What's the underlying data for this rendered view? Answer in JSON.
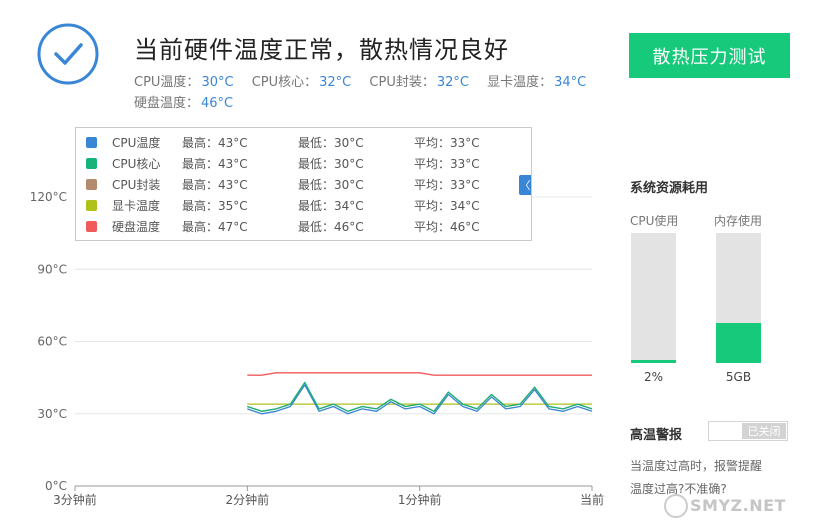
{
  "header": {
    "status_icon": "checkmark-circle-icon",
    "headline": "当前硬件温度正常，散热情况良好",
    "readings": [
      {
        "label": "CPU温度：",
        "value": "30°C"
      },
      {
        "label": "CPU核心：",
        "value": "32°C"
      },
      {
        "label": "CPU封装：",
        "value": "32°C"
      },
      {
        "label": "显卡温度：",
        "value": "34°C"
      },
      {
        "label": "硬盘温度：",
        "value": "46°C"
      }
    ],
    "stress_test_button": "散热压力测试"
  },
  "legend": {
    "rows": [
      {
        "name": "CPU温度",
        "max": "最高：43°C",
        "min": "最低：30°C",
        "avg": "平均：33°C",
        "color": "#3a86d6"
      },
      {
        "name": "CPU核心",
        "max": "最高：43°C",
        "min": "最低：30°C",
        "avg": "平均：33°C",
        "color": "#17b37a"
      },
      {
        "name": "CPU封装",
        "max": "最高：43°C",
        "min": "最低：30°C",
        "avg": "平均：33°C",
        "color": "#b38a6b"
      },
      {
        "name": "显卡温度",
        "max": "最高：35°C",
        "min": "最低：34°C",
        "avg": "平均：34°C",
        "color": "#aec21a"
      },
      {
        "name": "硬盘温度",
        "max": "最高：47°C",
        "min": "最低：46°C",
        "avg": "平均：46°C",
        "color": "#f05a5a"
      }
    ],
    "collapse_glyph": "〈"
  },
  "chart_data": {
    "type": "line",
    "ylabel": "",
    "xlabel": "",
    "y_ticks": [
      "120°C",
      "90°C",
      "60°C",
      "30°C",
      "0°C"
    ],
    "ylim": [
      0,
      120
    ],
    "x_ticks": [
      "3分钟前",
      "2分钟前",
      "1分钟前",
      "当前"
    ],
    "xlim": [
      -180,
      0
    ],
    "grid": true,
    "x_seconds": [
      -120,
      -115,
      -110,
      -105,
      -100,
      -95,
      -90,
      -85,
      -80,
      -75,
      -70,
      -65,
      -60,
      -55,
      -50,
      -45,
      -40,
      -35,
      -30,
      -25,
      -20,
      -15,
      -10,
      -5,
      0
    ],
    "series": [
      {
        "name": "CPU温度",
        "color": "#3a86d6",
        "values": [
          32,
          30,
          31,
          33,
          42,
          31,
          33,
          30,
          32,
          31,
          35,
          32,
          33,
          30,
          38,
          33,
          31,
          37,
          32,
          33,
          40,
          32,
          31,
          33,
          31
        ]
      },
      {
        "name": "CPU核心",
        "color": "#17b37a",
        "values": [
          33,
          31,
          32,
          34,
          43,
          32,
          34,
          31,
          33,
          32,
          36,
          33,
          34,
          31,
          39,
          34,
          32,
          38,
          33,
          34,
          41,
          33,
          32,
          34,
          32
        ]
      },
      {
        "name": "CPU封装",
        "color": "#b38a6b",
        "values": [
          33,
          31,
          32,
          34,
          42,
          32,
          34,
          31,
          33,
          32,
          36,
          33,
          34,
          31,
          39,
          34,
          32,
          38,
          33,
          34,
          41,
          33,
          32,
          34,
          32
        ]
      },
      {
        "name": "显卡温度",
        "color": "#aec21a",
        "values": [
          34,
          34,
          34,
          34,
          34,
          34,
          34,
          34,
          34,
          34,
          34,
          34,
          34,
          34,
          34,
          34,
          34,
          34,
          34,
          34,
          34,
          34,
          34,
          34,
          34
        ]
      },
      {
        "name": "硬盘温度",
        "color": "#f05a5a",
        "values": [
          46,
          46,
          47,
          47,
          47,
          47,
          47,
          47,
          47,
          47,
          47,
          47,
          47,
          46,
          46,
          46,
          46,
          46,
          46,
          46,
          46,
          46,
          46,
          46,
          46
        ]
      }
    ]
  },
  "resources": {
    "title": "系统资源耗用",
    "cpu": {
      "label": "CPU使用",
      "value": "2%",
      "fraction": 0.02
    },
    "memory": {
      "label": "内存使用",
      "value": "5GB",
      "fraction": 0.31
    },
    "bar_color": "#17c97a"
  },
  "alert": {
    "title": "高温警报",
    "toggle_state": "已关闭",
    "description": "当温度过高时，报警提醒",
    "link": "温度过高?不准确?"
  },
  "watermark": {
    "text": "SMYZ.NET"
  }
}
